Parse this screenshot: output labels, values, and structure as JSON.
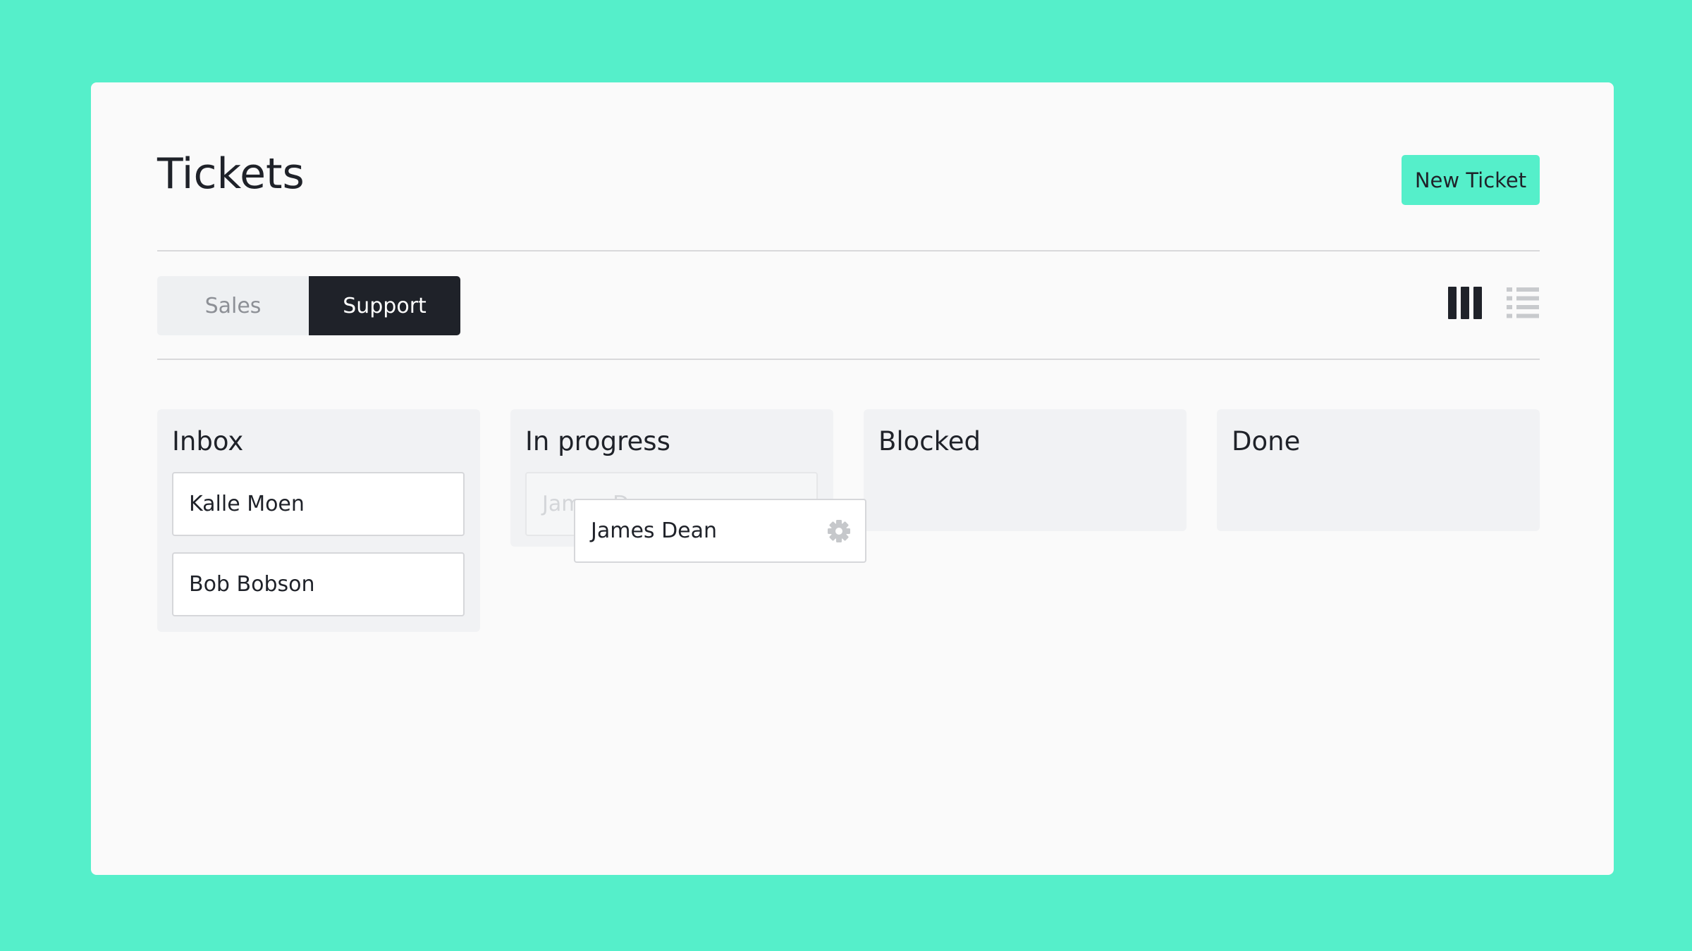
{
  "page": {
    "title": "Tickets"
  },
  "header": {
    "new_ticket_label": "New Ticket"
  },
  "tabs": [
    {
      "label": "Sales",
      "active": false
    },
    {
      "label": "Support",
      "active": true
    }
  ],
  "view_toggle": {
    "board_icon": "columns-icon",
    "list_icon": "list-icon",
    "active": "board"
  },
  "columns": [
    {
      "title": "Inbox",
      "tickets": [
        "Kalle Moen",
        "Bob Bobson"
      ]
    },
    {
      "title": "In progress",
      "tickets": [
        "James Dean"
      ]
    },
    {
      "title": "Blocked",
      "tickets": []
    },
    {
      "title": "Done",
      "tickets": []
    }
  ],
  "dragging_ticket": {
    "label": "James Dean",
    "icon": "gear-icon"
  },
  "colors": {
    "accent": "#55efca",
    "dark": "#1f2229",
    "card_background": "#fafafa",
    "column_background": "#f1f2f4"
  }
}
